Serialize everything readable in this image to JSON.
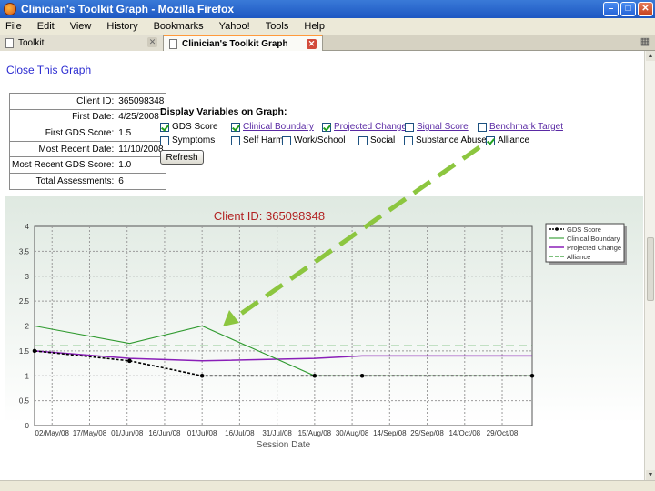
{
  "window": {
    "title": "Clinician's Toolkit Graph - Mozilla Firefox"
  },
  "menu": [
    "File",
    "Edit",
    "View",
    "History",
    "Bookmarks",
    "Yahoo!",
    "Tools",
    "Help"
  ],
  "tabs": [
    {
      "label": "Toolkit",
      "active": false
    },
    {
      "label": "Clinician's Toolkit Graph",
      "active": true
    }
  ],
  "page": {
    "close_link": "Close This Graph",
    "info": [
      {
        "label": "Client ID:",
        "value": "365098348"
      },
      {
        "label": "First Date:",
        "value": "4/25/2008"
      },
      {
        "label": "First GDS Score:",
        "value": "1.5"
      },
      {
        "label": "Most Recent Date:",
        "value": "11/10/2008"
      },
      {
        "label": "Most Recent GDS Score:",
        "value": "1.0"
      },
      {
        "label": "Total Assessments:",
        "value": "6"
      }
    ],
    "vars_title": "Display Variables on Graph:",
    "vars_row1": [
      {
        "label": "GDS Score",
        "checked": true,
        "link": false
      },
      {
        "label": "Clinical Boundary",
        "checked": true,
        "link": true
      },
      {
        "label": "Projected Change",
        "checked": true,
        "link": true
      },
      {
        "label": "Signal Score",
        "checked": false,
        "link": true
      },
      {
        "label": "Benchmark Target",
        "checked": false,
        "link": true
      }
    ],
    "vars_row2": [
      {
        "label": "Symptoms",
        "checked": false,
        "link": false
      },
      {
        "label": "Self Harm",
        "checked": false,
        "link": false
      },
      {
        "label": "Work/School",
        "checked": false,
        "link": false
      },
      {
        "label": "Social",
        "checked": false,
        "link": false
      },
      {
        "label": "Substance Abuse",
        "checked": false,
        "link": false
      },
      {
        "label": "Alliance",
        "checked": true,
        "link": false
      }
    ],
    "refresh_label": "Refresh"
  },
  "chart_data": {
    "type": "line",
    "title": "Client ID: 365098348",
    "xlabel": "Session Date",
    "ylabel": "",
    "x": [
      "02/May/08",
      "17/May/08",
      "01/Jun/08",
      "16/Jun/08",
      "01/Jul/08",
      "16/Jul/08",
      "31/Jul/08",
      "15/Aug/08",
      "30/Aug/08",
      "14/Sep/08",
      "29/Sep/08",
      "14/Oct/08",
      "29/Oct/08"
    ],
    "ylim": [
      0,
      4
    ],
    "yticks": [
      "0",
      "0.5",
      "1",
      "1.5",
      "2",
      "2.5",
      "3",
      "3.5",
      "4"
    ],
    "grid": true,
    "legend_position": "right",
    "series": [
      {
        "name": "GDS Score",
        "color": "#000000",
        "points": [
          [
            "2008-04-25",
            1.5
          ],
          [
            "2008-06-02",
            1.3
          ],
          [
            "2008-07-01",
            1.0
          ],
          [
            "2008-08-15",
            1.0
          ],
          [
            "2008-09-03",
            1.0
          ],
          [
            "2008-11-10",
            1.0
          ]
        ]
      },
      {
        "name": "Clinical Boundary",
        "color": "#2f9a2f",
        "points": [
          [
            "2008-04-25",
            2.0
          ],
          [
            "2008-06-02",
            1.65
          ],
          [
            "2008-07-01",
            2.0
          ],
          [
            "2008-08-15",
            1.0
          ],
          [
            "2008-09-03",
            1.0
          ],
          [
            "2008-11-10",
            1.0
          ]
        ]
      },
      {
        "name": "Projected Change",
        "color": "#8a1fb8",
        "points": [
          [
            "2008-04-25",
            1.5
          ],
          [
            "2008-06-02",
            1.35
          ],
          [
            "2008-07-01",
            1.3
          ],
          [
            "2008-08-15",
            1.35
          ],
          [
            "2008-09-03",
            1.4
          ],
          [
            "2008-11-10",
            1.4
          ]
        ]
      },
      {
        "name": "Alliance",
        "color": "#2f9a2f",
        "points": [
          [
            "2008-04-25",
            1.6
          ],
          [
            "2008-11-10",
            1.6
          ]
        ]
      }
    ]
  },
  "colors": {
    "annotation_arrow": "#8cc63f",
    "link": "#5a2aa4",
    "close_link": "#2b2bd1",
    "title_red": "#b22222"
  },
  "icons": {
    "app": "firefox-icon",
    "tab_close": "close-icon",
    "new_tab": "new-tab-icon"
  }
}
